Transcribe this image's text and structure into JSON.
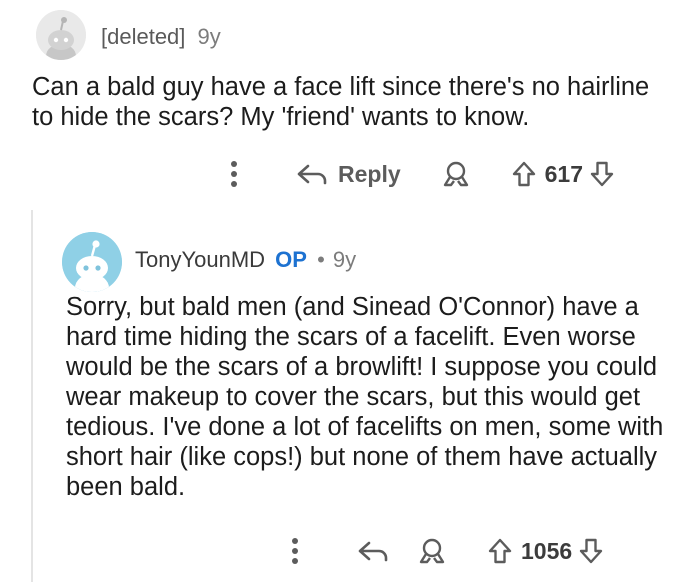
{
  "parent": {
    "author": "[deleted]",
    "age": "9y",
    "body": "Can a bald guy have a face lift since there's no hairline to hide the scars? My 'friend' wants to know.",
    "actions": {
      "reply_label": "Reply",
      "score": "617"
    }
  },
  "reply": {
    "author": "TonyYounMD",
    "op_badge": "OP",
    "separator": "•",
    "age": "9y",
    "body": "Sorry, but bald men (and Sinead O'Connor) have a hard time hiding the scars of a facelift. Even worse would be the scars of a browlift! I suppose you could wear makeup to cover the scars, but this would get tedious. I've done a lot of facelifts on men, some with short hair (like cops!) but none of them have actually been bald.",
    "actions": {
      "score": "1056"
    }
  },
  "colors": {
    "op": "#1d72d1",
    "reply_avatar_bg": "#8fd0e6",
    "deleted_avatar_bg": "#e9e9e9"
  },
  "icons": [
    "snoo-avatar-icon",
    "more-options-icon",
    "reply-arrow-icon",
    "award-icon",
    "upvote-icon",
    "downvote-icon"
  ]
}
